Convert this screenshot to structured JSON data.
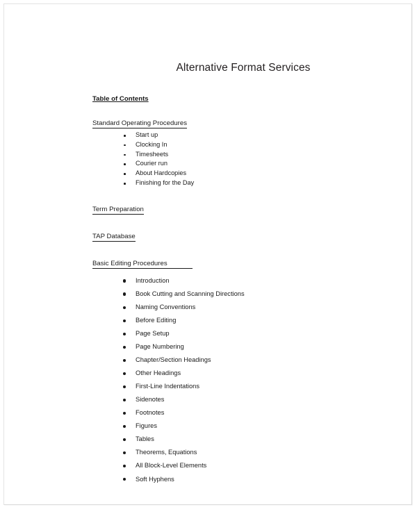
{
  "document": {
    "title": "Alternative Format Services",
    "toc_heading": "Table of Contents",
    "sections": [
      {
        "heading": "Standard Operating Procedures",
        "underline_extended": false,
        "list_style": "compact",
        "items": [
          "Start up",
          "Clocking In",
          "Timesheets",
          "Courier run",
          "About Hardcopies",
          "Finishing for the Day"
        ]
      },
      {
        "heading": "Term Preparation",
        "underline_extended": false,
        "list_style": "none",
        "items": []
      },
      {
        "heading": "TAP Database",
        "underline_extended": false,
        "list_style": "none",
        "items": []
      },
      {
        "heading": "Basic Editing Procedures",
        "underline_extended": true,
        "list_style": "spaced",
        "items": [
          "Introduction",
          "Book Cutting and Scanning Directions",
          "Naming Conventions",
          "Before Editing",
          "Page Setup",
          "Page Numbering",
          "Chapter/Section Headings",
          "Other Headings",
          "First-Line Indentations",
          "Sidenotes",
          "Footnotes",
          "Figures",
          "Tables",
          "Theorems, Equations",
          "All Block-Level Elements",
          "Soft Hyphens"
        ]
      }
    ]
  },
  "colors": {
    "text": "#1b1b1b",
    "title": "#231f20",
    "page_background": "#ffffff",
    "page_border": "#e3e3e3"
  }
}
